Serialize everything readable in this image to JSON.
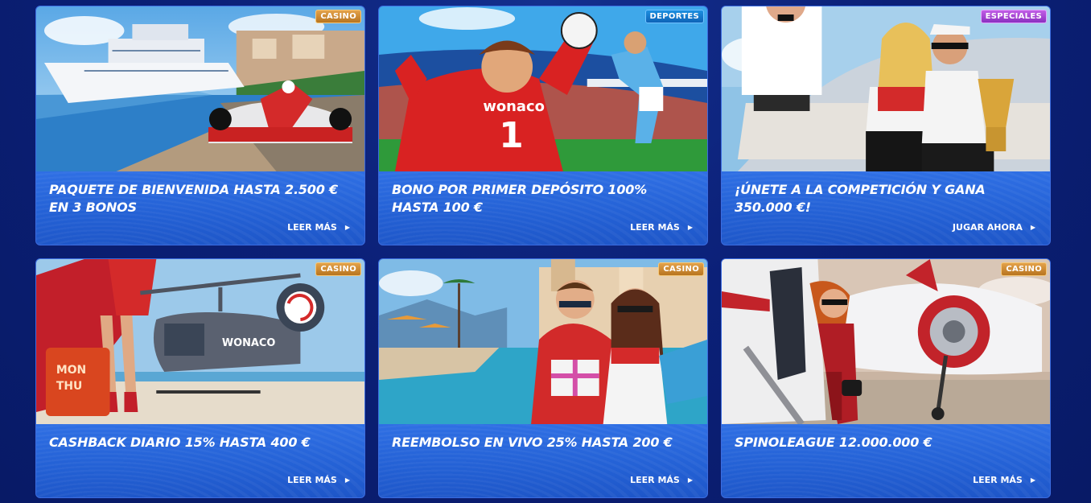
{
  "promotions": [
    {
      "badge": "CASINO",
      "badge_type": "casino",
      "title": "PAQUETE DE BIENVENIDA HASTA 2.500 € EN 3 BONOS",
      "cta": "LEER MÁS",
      "arrow_icon": "triangle-right-icon",
      "image": "yacht-race-car-image",
      "cta_arrow": "▶"
    },
    {
      "badge": "DEPORTES",
      "badge_type": "deportes",
      "title": "BONO POR PRIMER DEPÓSITO 100% HASTA 100 €",
      "cta": "LEER MÁS",
      "arrow_icon": "triangle-right-icon",
      "image": "football-goalkeeper-image",
      "cta_arrow": "▶"
    },
    {
      "badge": "ESPECIALES",
      "badge_type": "especiales",
      "title": "¡ÚNETE A LA COMPETICIÓN Y GANA 350.000 €!",
      "cta": "JUGAR AHORA",
      "arrow_icon": "triangle-right-icon",
      "image": "luxury-car-trophy-image",
      "cta_arrow": "▶"
    },
    {
      "badge": "CASINO",
      "badge_type": "casino",
      "title": "CASHBACK DIARIO 15% HASTA 400 €",
      "cta": "LEER MÁS",
      "arrow_icon": "triangle-right-icon",
      "image": "helicopter-suitcase-image",
      "cta_arrow": "▶"
    },
    {
      "badge": "CASINO",
      "badge_type": "casino",
      "title": "REEMBOLSO EN VIVO 25% HASTA 200 €",
      "cta": "LEER MÁS",
      "arrow_icon": "triangle-right-icon",
      "image": "pool-couple-gift-image",
      "cta_arrow": "▶"
    },
    {
      "badge": "CASINO",
      "badge_type": "casino",
      "title": "SPINOLEAGUE 12.000.000 €",
      "cta": "LEER MÁS",
      "arrow_icon": "triangle-right-icon",
      "image": "private-jet-woman-image",
      "cta_arrow": "▶"
    }
  ],
  "colors": {
    "background": "#0b2078",
    "card_body": "#2563d6",
    "badge_casino": "#c98632",
    "badge_deportes": "#1577cc",
    "badge_especiales": "#a646d4"
  }
}
